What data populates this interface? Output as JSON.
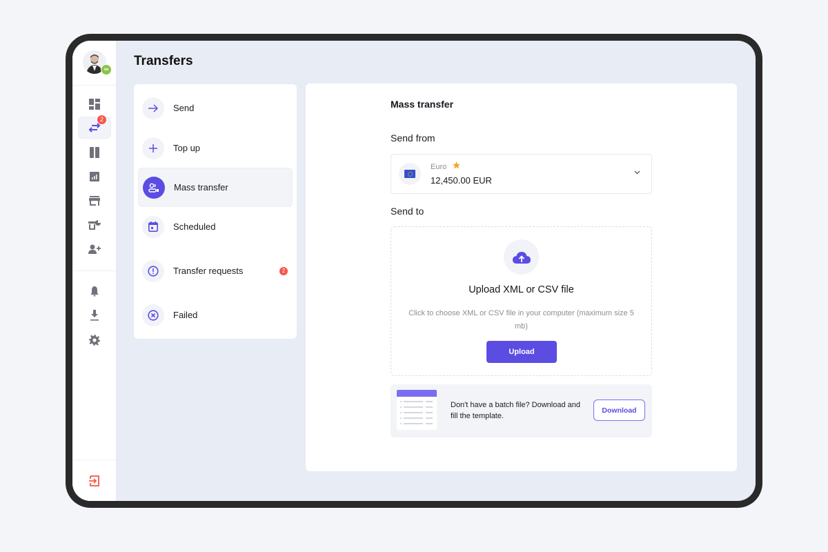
{
  "page": {
    "title": "Transfers"
  },
  "sidebar": {
    "avatar_badge": "∞",
    "transfers_badge": "2",
    "icons": [
      {
        "name": "dashboard-icon"
      },
      {
        "name": "transfers-icon",
        "active": true
      },
      {
        "name": "cards-icon"
      },
      {
        "name": "analytics-icon"
      },
      {
        "name": "store-icon"
      },
      {
        "name": "statistics-icon"
      },
      {
        "name": "add-user-icon"
      },
      {
        "name": "bell-icon"
      },
      {
        "name": "download-icon"
      },
      {
        "name": "gear-icon"
      },
      {
        "name": "logout-icon"
      }
    ]
  },
  "menu": {
    "items": [
      {
        "label": "Send",
        "icon": "arrow-right-icon"
      },
      {
        "label": "Top up",
        "icon": "plus-icon"
      },
      {
        "label": "Mass transfer",
        "icon": "mass-transfer-icon",
        "active": true
      },
      {
        "label": "Scheduled",
        "icon": "calendar-icon"
      },
      {
        "label": "Transfer requests",
        "icon": "exclamation-icon",
        "badge": "2"
      },
      {
        "label": "Failed",
        "icon": "x-circle-icon"
      }
    ]
  },
  "content": {
    "section_title": "Mass transfer",
    "send_from_label": "Send from",
    "send_from": {
      "currency_name": "Euro",
      "amount": "12,450.00 EUR"
    },
    "send_to_label": "Send to",
    "upload": {
      "title": "Upload XML or CSV file",
      "description": "Click to choose XML or CSV file in your computer (maximum size 5 mb)",
      "button_label": "Upload"
    },
    "template": {
      "text": "Don't have a batch file? Download and fill the template.",
      "button_label": "Download"
    }
  },
  "colors": {
    "accent": "#5b4de2",
    "badge": "#f5564a",
    "star": "#f5a623",
    "logout": "#f5564a"
  }
}
